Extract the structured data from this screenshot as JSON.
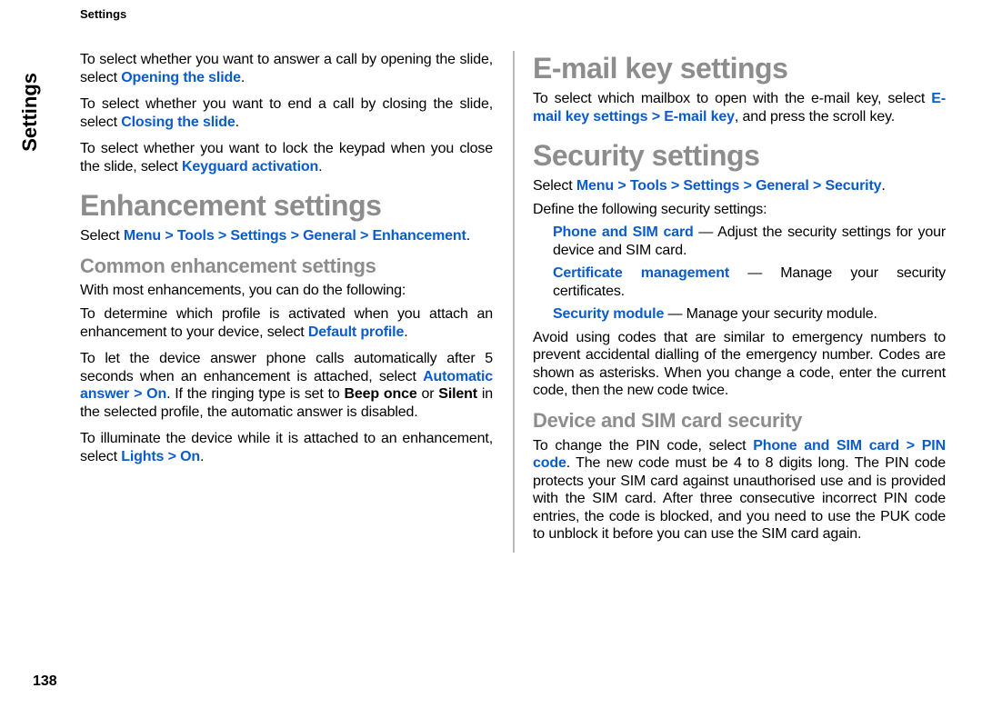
{
  "header": "Settings",
  "sidebar": "Settings",
  "pageNumber": "138",
  "col1": {
    "p1_a": "To select whether you want to answer a call by opening the slide, select ",
    "p1_link": "Opening the slide",
    "p2_a": "To select whether you want to end a call by closing the slide, select ",
    "p2_link": "Closing the slide",
    "p3_a": "To select whether you want to lock the keypad when you close the slide, select ",
    "p3_link": "Keyguard activation",
    "h1": "Enhancement settings",
    "nav_a": "Select ",
    "nav_menu": "Menu",
    "nav_tools": "Tools",
    "nav_settings": "Settings",
    "nav_general": "General",
    "nav_enh": "Enhancement",
    "h2": "Common enhancement settings",
    "p4": "With most enhancements, you can do the following:",
    "p5_a": "To determine which profile is activated when you attach an enhancement to your device, select ",
    "p5_link": "Default profile",
    "p6_a": "To let the device answer phone calls automatically after 5 seconds when an enhancement is attached, select ",
    "p6_link1": "Automatic answer",
    "p6_link2": "On",
    "p6_b": ". If the ringing type is set to ",
    "p6_link3": "Beep once",
    "p6_c": " or ",
    "p6_link4": "Silent",
    "p6_d": " in the selected profile, the automatic answer is disabled.",
    "p7_a": "To illuminate the device while it is attached to an enhancement, select ",
    "p7_link1": "Lights",
    "p7_link2": "On"
  },
  "col2": {
    "h1a": "E-mail key settings",
    "p1_a": "To select which mailbox to open with the e-mail key, select ",
    "p1_link1": "E-mail key settings",
    "p1_link2": "E-mail key",
    "p1_b": ", and press the scroll key.",
    "h1b": "Security settings",
    "nav_a": "Select ",
    "nav_menu": "Menu",
    "nav_tools": "Tools",
    "nav_settings": "Settings",
    "nav_general": "General",
    "nav_sec": "Security",
    "p2": "Define the following security settings:",
    "li1_link": "Phone and SIM card",
    "li1_b": " — Adjust the security settings for your device and SIM card.",
    "li2_link": "Certificate management",
    "li2_b": " — Manage your security certificates.",
    "li3_link": "Security module",
    "li3_b": " — Manage your security module.",
    "p3": "Avoid using codes that are similar to emergency numbers to prevent accidental dialling of the emergency number. Codes are shown as asterisks. When you change a code, enter the current code, then the new code twice.",
    "h2": "Device and SIM card security",
    "p4_a": "To change the PIN code, select ",
    "p4_link1": "Phone and SIM card",
    "p4_link2": "PIN code",
    "p4_b": ". The new code must be 4 to 8 digits long. The PIN code protects your SIM card against unauthorised use and is provided with the SIM card. After three consecutive incorrect PIN code entries, the code is blocked, and you need to use the PUK code to unblock it before you can use the SIM card again."
  },
  "gt": " > "
}
